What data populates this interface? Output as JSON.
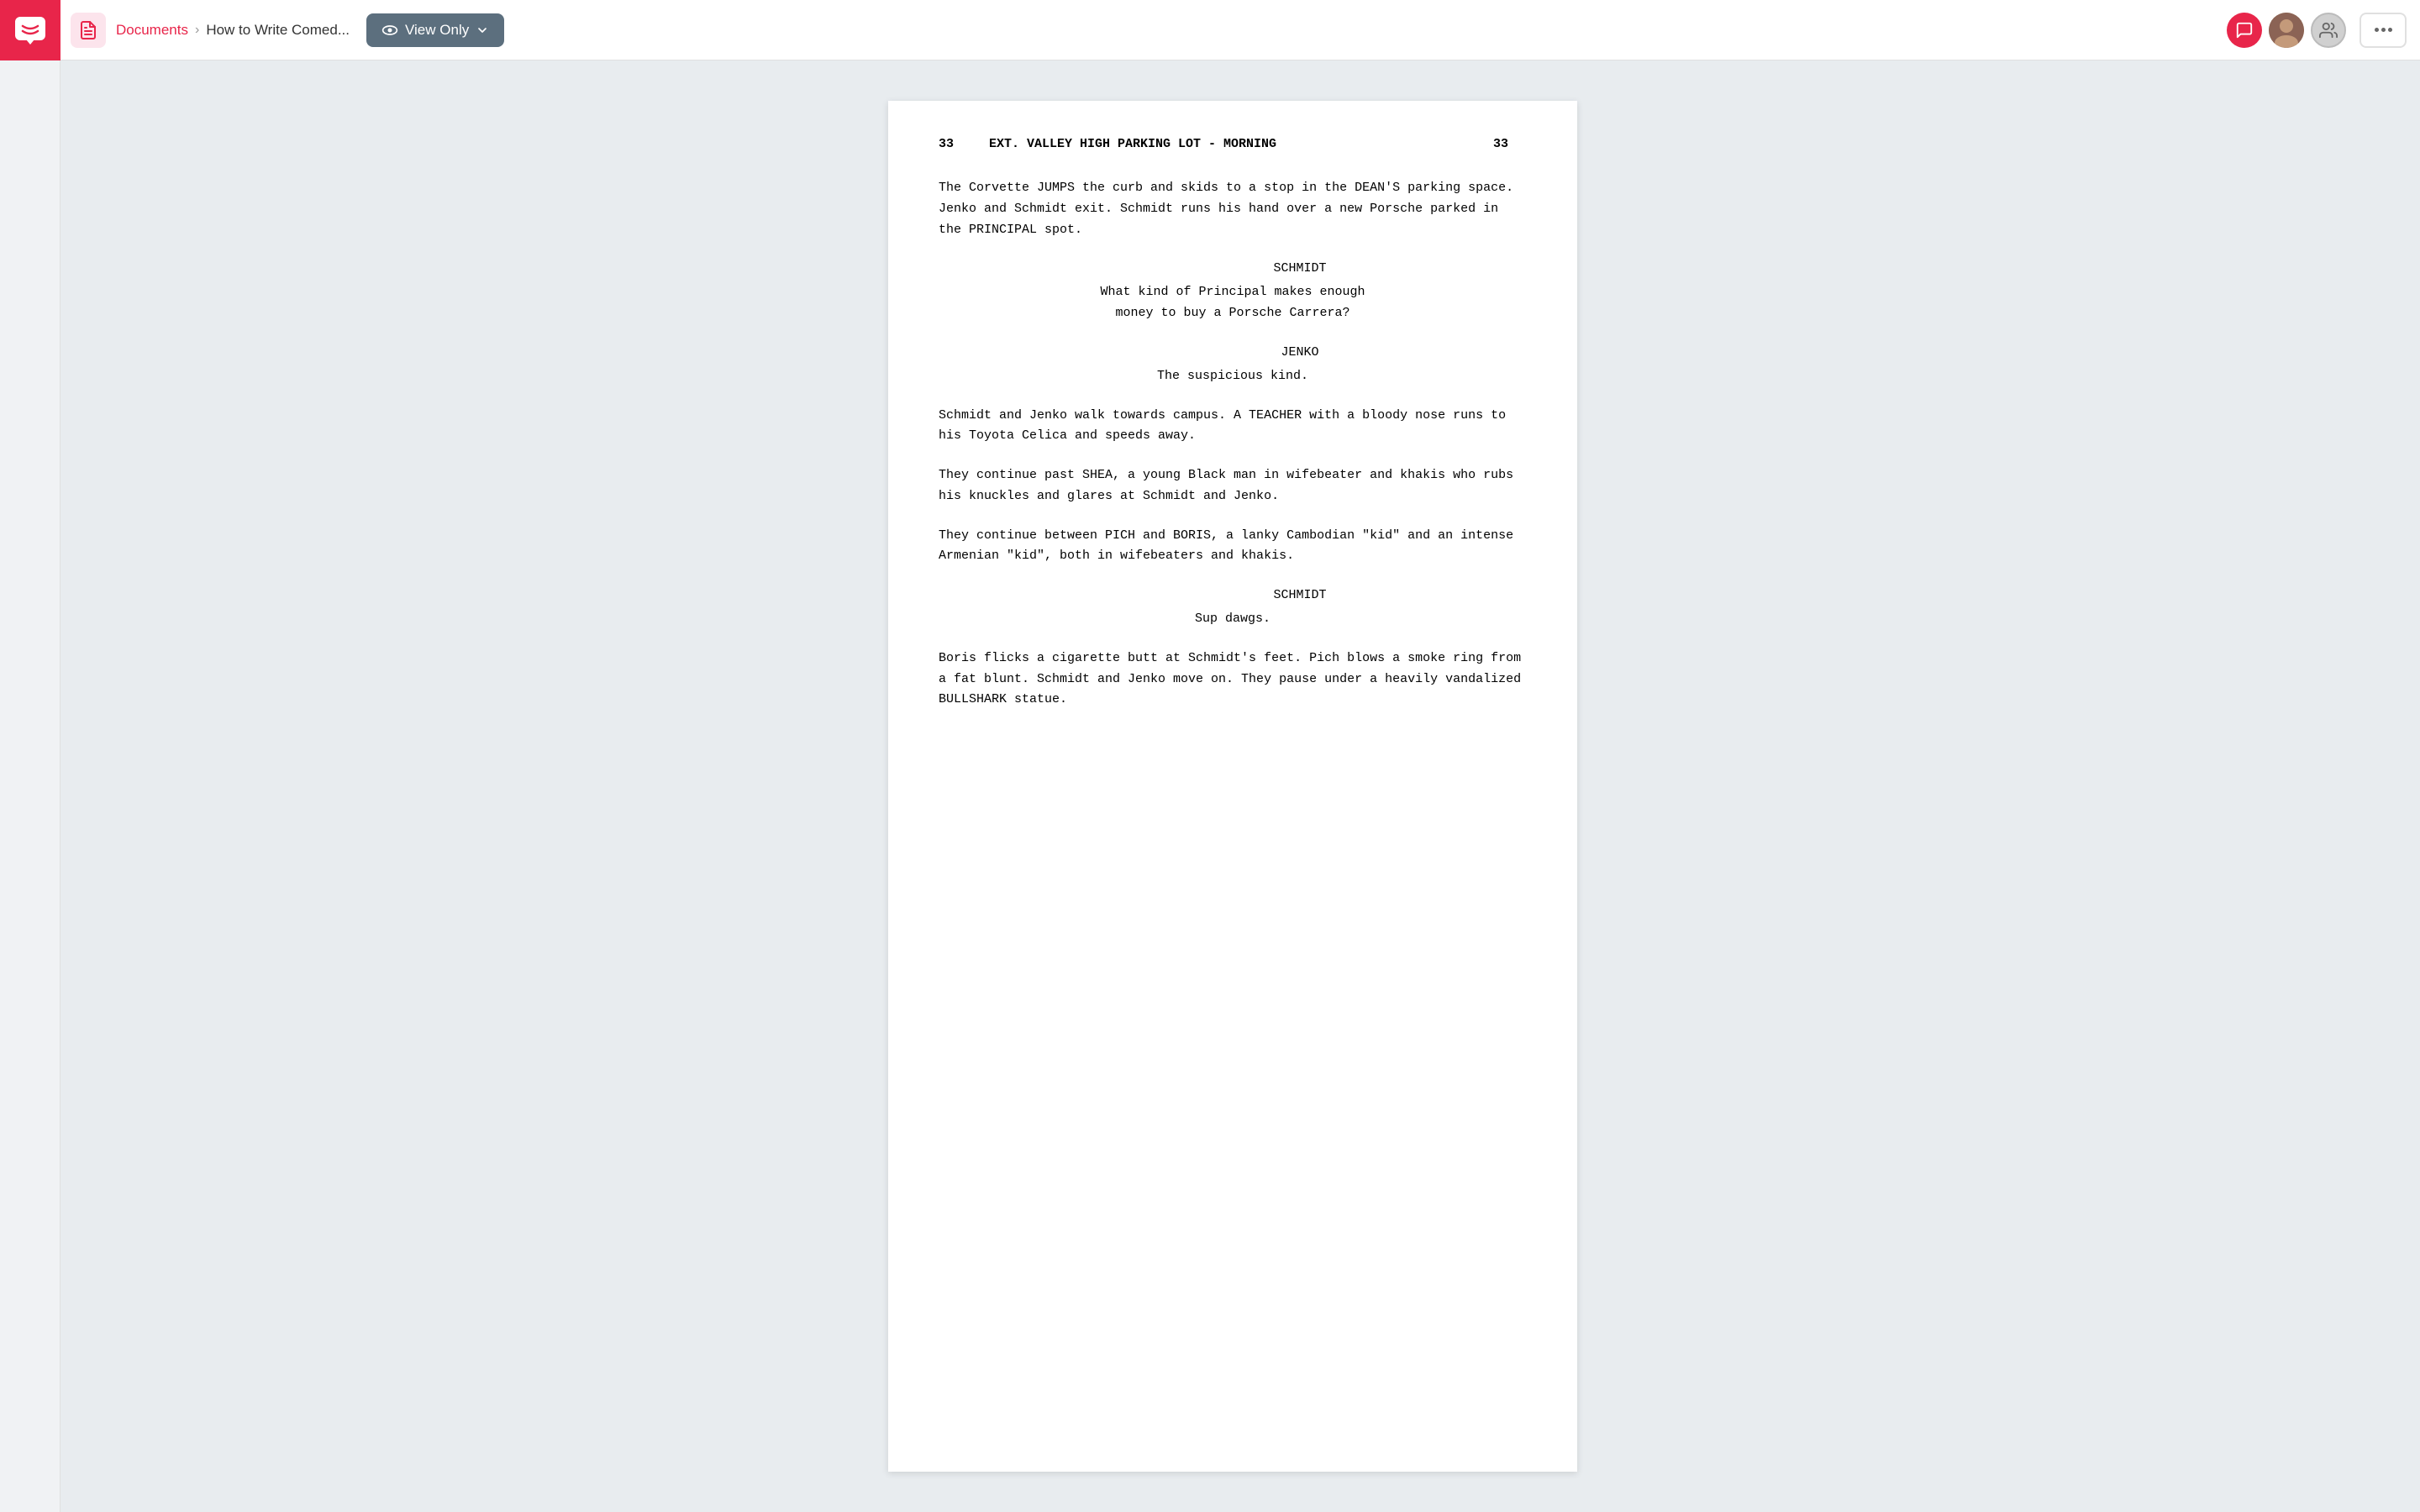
{
  "topbar": {
    "documents_label": "Documents",
    "document_title": "How to Write Comed...",
    "view_only_label": "View Only"
  },
  "script": {
    "scene_number_left": "33",
    "scene_number_right": "33",
    "scene_heading": "EXT. VALLEY HIGH PARKING LOT - MORNING",
    "action1": "The Corvette JUMPS the curb and skids to a stop in the DEAN'S parking space. Jenko and Schmidt exit. Schmidt runs his hand over a new Porsche parked in the PRINCIPAL spot.",
    "dialogue1": {
      "character": "SCHMIDT",
      "lines": "What kind of Principal makes enough\nmoney to buy a Porsche Carrera?"
    },
    "dialogue2": {
      "character": "JENKO",
      "lines": "The suspicious kind."
    },
    "action2": "Schmidt and Jenko walk towards campus. A TEACHER with a bloody nose runs to his Toyota Celica and speeds away.",
    "action3": "They continue past SHEA, a young Black man in wifebeater and khakis who rubs his knuckles and glares at Schmidt and Jenko.",
    "action4": "They continue between PICH and BORIS, a lanky Cambodian \"kid\" and an intense Armenian \"kid\", both in wifebeaters and khakis.",
    "dialogue3": {
      "character": "SCHMIDT",
      "lines": "Sup dawgs."
    },
    "action5": "Boris flicks a cigarette butt at Schmidt's feet. Pich blows a smoke ring from a fat blunt. Schmidt and Jenko move on. They pause under a heavily vandalized BULLSHARK statue."
  }
}
